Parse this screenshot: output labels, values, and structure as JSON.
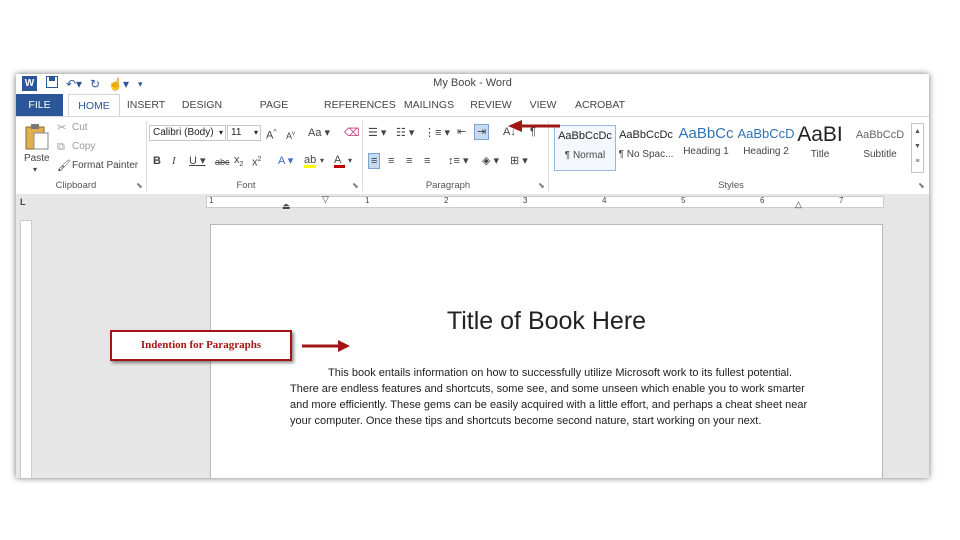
{
  "window": {
    "title": "My Book - Word"
  },
  "tabs": [
    "FILE",
    "HOME",
    "INSERT",
    "DESIGN",
    "PAGE LAYOUT",
    "REFERENCES",
    "MAILINGS",
    "REVIEW",
    "VIEW",
    "ACROBAT"
  ],
  "clipboard": {
    "paste": "Paste",
    "cut": "Cut",
    "copy": "Copy",
    "format_painter": "Format Painter",
    "label": "Clipboard"
  },
  "font": {
    "name": "Calibri (Body)",
    "size": "11",
    "label": "Font"
  },
  "paragraph": {
    "label": "Paragraph"
  },
  "styles": {
    "label": "Styles",
    "items": [
      {
        "preview": "AaBbCcDc",
        "name": "¶ Normal"
      },
      {
        "preview": "AaBbCcDc",
        "name": "¶ No Spac..."
      },
      {
        "preview": "AaBbCc",
        "name": "Heading 1"
      },
      {
        "preview": "AaBbCcD",
        "name": "Heading 2"
      },
      {
        "preview": "AaBI",
        "name": "Title"
      },
      {
        "preview": "AaBbCcD",
        "name": "Subtitle"
      }
    ]
  },
  "ruler": {
    "numbers": [
      "1",
      "1",
      "2",
      "3",
      "4",
      "5",
      "6",
      "7"
    ]
  },
  "document": {
    "title": "Title of Book Here",
    "body": "This book entails information on how to successfully utilize Microsoft work to its fullest potential.  There are endless features and shortcuts, some see, and some unseen which enable you to work smarter and more efficiently.  These gems can be easily acquired with a little effort, and perhaps a cheat sheet near your computer.  Once these tips and shortcuts become second nature, start working on your next."
  },
  "annotation": {
    "label": "Indention for Paragraphs",
    "color": "#a31515"
  },
  "colors": {
    "accent": "#2b579a",
    "annotation": "#a31515"
  }
}
